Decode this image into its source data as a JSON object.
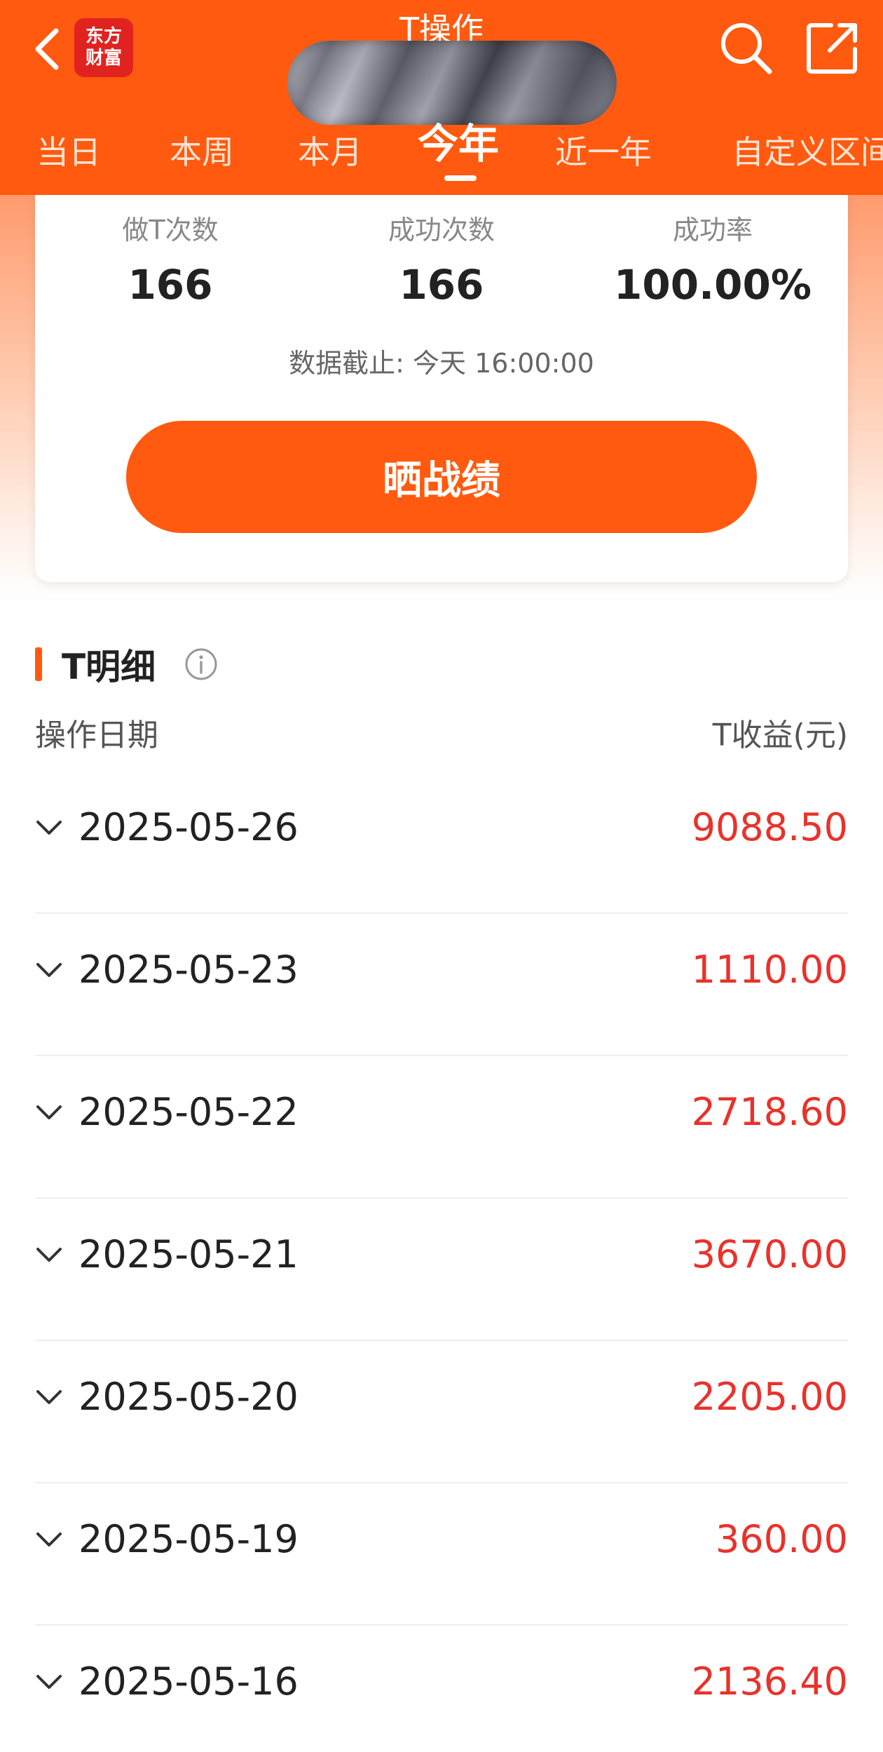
{
  "header": {
    "title": "T操作",
    "logo_line1": "东方",
    "logo_line2": "财富",
    "tabs": [
      {
        "label": "当日",
        "active": false
      },
      {
        "label": "本周",
        "active": false
      },
      {
        "label": "本月",
        "active": false
      },
      {
        "label": "今年",
        "active": true
      },
      {
        "label": "近一年",
        "active": false
      },
      {
        "label": "自定义区间",
        "active": false
      }
    ],
    "icons": {
      "back": "chevron-left-icon",
      "search": "search-icon",
      "share": "share-icon"
    },
    "accent_color": "#ff5a0f"
  },
  "stats": {
    "items": [
      {
        "label": "做T次数",
        "value": "166"
      },
      {
        "label": "成功次数",
        "value": "166"
      },
      {
        "label": "成功率",
        "value": "100.00%"
      }
    ],
    "cutoff_text": "数据截止: 今天 16:00:00",
    "share_button_label": "晒战绩"
  },
  "detail": {
    "title": "T明细",
    "col_date": "操作日期",
    "col_profit": "T收益(元)",
    "profit_color": "#e8322b",
    "rows": [
      {
        "date": "2025-05-26",
        "profit": "9088.50"
      },
      {
        "date": "2025-05-23",
        "profit": "1110.00"
      },
      {
        "date": "2025-05-22",
        "profit": "2718.60"
      },
      {
        "date": "2025-05-21",
        "profit": "3670.00"
      },
      {
        "date": "2025-05-20",
        "profit": "2205.00"
      },
      {
        "date": "2025-05-19",
        "profit": "360.00"
      },
      {
        "date": "2025-05-16",
        "profit": "2136.40"
      }
    ]
  }
}
